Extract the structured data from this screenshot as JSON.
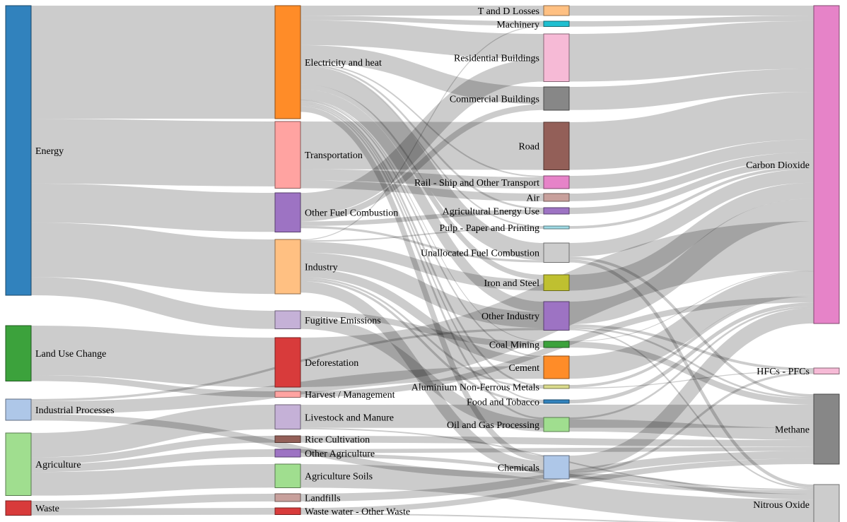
{
  "chart_data": {
    "type": "sankey",
    "title": "",
    "nodes": [
      {
        "name": "Energy",
        "column": 0,
        "color": "#3182bd"
      },
      {
        "name": "Land Use Change",
        "column": 0,
        "color": "#3ca23c"
      },
      {
        "name": "Industrial Processes",
        "column": 0,
        "color": "#aec7e8"
      },
      {
        "name": "Agriculture",
        "column": 0,
        "color": "#a0de8f"
      },
      {
        "name": "Waste",
        "column": 0,
        "color": "#d83b3b"
      },
      {
        "name": "Electricity and heat",
        "column": 1,
        "color": "#ff8c28"
      },
      {
        "name": "Transportation",
        "column": 1,
        "color": "#ffa3a1"
      },
      {
        "name": "Other Fuel Combustion",
        "column": 1,
        "color": "#9d73c3"
      },
      {
        "name": "Industry",
        "column": 1,
        "color": "#ffc082"
      },
      {
        "name": "Fugitive Emissions",
        "column": 1,
        "color": "#c5b1d7"
      },
      {
        "name": "Deforestation",
        "column": 1,
        "color": "#d83b3b"
      },
      {
        "name": "Harvest / Management",
        "column": 1,
        "color": "#ffa3a1"
      },
      {
        "name": "Livestock and Manure",
        "column": 1,
        "color": "#c5b1d7"
      },
      {
        "name": "Rice Cultivation",
        "column": 1,
        "color": "#935f58"
      },
      {
        "name": "Other Agriculture",
        "column": 1,
        "color": "#9d73c3"
      },
      {
        "name": "Agriculture Soils",
        "column": 1,
        "color": "#a0de8f"
      },
      {
        "name": "Landfills",
        "column": 1,
        "color": "#c8a09c"
      },
      {
        "name": "Waste water - Other Waste",
        "column": 1,
        "color": "#d83b3b"
      },
      {
        "name": "T and D Losses",
        "column": 2,
        "color": "#ffc082"
      },
      {
        "name": "Machinery",
        "column": 2,
        "color": "#1fbfd0"
      },
      {
        "name": "Residential Buildings",
        "column": 2,
        "color": "#f6bad6"
      },
      {
        "name": "Commercial Buildings",
        "column": 2,
        "color": "#878787"
      },
      {
        "name": "Road",
        "column": 2,
        "color": "#935f58"
      },
      {
        "name": "Rail - Ship and Other Transport",
        "column": 2,
        "color": "#e683c8"
      },
      {
        "name": "Air",
        "column": 2,
        "color": "#c8a09c"
      },
      {
        "name": "Agricultural Energy Use",
        "column": 2,
        "color": "#9d73c3"
      },
      {
        "name": "Pulp - Paper and Printing",
        "column": 2,
        "color": "#9edae5"
      },
      {
        "name": "Unallocated Fuel Combustion",
        "column": 2,
        "color": "#cccccc"
      },
      {
        "name": "Iron and Steel",
        "column": 2,
        "color": "#bfc030"
      },
      {
        "name": "Other Industry",
        "column": 2,
        "color": "#9d73c3"
      },
      {
        "name": "Coal Mining",
        "column": 2,
        "color": "#3ca23c"
      },
      {
        "name": "Cement",
        "column": 2,
        "color": "#ff8c28"
      },
      {
        "name": "Aluminium Non-Ferrous Metals",
        "column": 2,
        "color": "#dbdc8d"
      },
      {
        "name": "Food and Tobacco",
        "column": 2,
        "color": "#3182bd"
      },
      {
        "name": "Oil and Gas Processing",
        "column": 2,
        "color": "#a0de8f"
      },
      {
        "name": "Chemicals",
        "column": 2,
        "color": "#aec7e8"
      },
      {
        "name": "Carbon Dioxide",
        "column": 3,
        "color": "#e683c8"
      },
      {
        "name": "HFCs - PFCs",
        "column": 3,
        "color": "#f6bad6"
      },
      {
        "name": "Methane",
        "column": 3,
        "color": "#878787"
      },
      {
        "name": "Nitrous Oxide",
        "column": 3,
        "color": "#cccccc"
      }
    ],
    "links": [
      {
        "source": "Agriculture",
        "target": "Agriculture Soils",
        "value": 5.2
      },
      {
        "source": "Agriculture",
        "target": "Livestock and Manure",
        "value": 5.4
      },
      {
        "source": "Agriculture",
        "target": "Other Agriculture",
        "value": 1.7
      },
      {
        "source": "Agriculture",
        "target": "Rice Cultivation",
        "value": 1.5
      },
      {
        "source": "Energy",
        "target": "Fugitive Emissions",
        "value": 4.0
      },
      {
        "source": "Energy",
        "target": "Industry",
        "value": 12.0
      },
      {
        "source": "Energy",
        "target": "Electricity and heat",
        "value": 24.9
      },
      {
        "source": "Energy",
        "target": "Transportation",
        "value": 14.3
      },
      {
        "source": "Energy",
        "target": "Other Fuel Combustion",
        "value": 8.6
      },
      {
        "source": "Industrial Processes",
        "target": "Cement",
        "value": 2.8
      },
      {
        "source": "Industrial Processes",
        "target": "Chemicals",
        "value": 1.4
      },
      {
        "source": "Industrial Processes",
        "target": "Other Industry",
        "value": 0.5
      },
      {
        "source": "Land Use Change",
        "target": "Deforestation",
        "value": 10.9
      },
      {
        "source": "Land Use Change",
        "target": "Harvest / Management",
        "value": 1.3
      },
      {
        "source": "Waste",
        "target": "Landfills",
        "value": 1.7
      },
      {
        "source": "Waste",
        "target": "Waste water - Other Waste",
        "value": 1.5
      },
      {
        "source": "Electricity and heat",
        "target": "Residential Buildings",
        "value": 5.5
      },
      {
        "source": "Electricity and heat",
        "target": "Commercial Buildings",
        "value": 3.8
      },
      {
        "source": "Electricity and heat",
        "target": "Iron and Steel",
        "value": 1.1
      },
      {
        "source": "Electricity and heat",
        "target": "Other Industry",
        "value": 2.3
      },
      {
        "source": "Electricity and heat",
        "target": "Aluminium Non-Ferrous Metals",
        "value": 0.4
      },
      {
        "source": "Electricity and heat",
        "target": "Food and Tobacco",
        "value": 0.3
      },
      {
        "source": "Electricity and heat",
        "target": "Chemicals",
        "value": 1.2
      },
      {
        "source": "Electricity and heat",
        "target": "Pulp - Paper and Printing",
        "value": 0.3
      },
      {
        "source": "Electricity and heat",
        "target": "Machinery",
        "value": 1.0
      },
      {
        "source": "Electricity and heat",
        "target": "Agricultural Energy Use",
        "value": 0.4
      },
      {
        "source": "Electricity and heat",
        "target": "T and D Losses",
        "value": 2.2
      },
      {
        "source": "Electricity and heat",
        "target": "Unallocated Fuel Combustion",
        "value": 3.8
      },
      {
        "source": "Electricity and heat",
        "target": "Coal Mining",
        "value": 0.1
      },
      {
        "source": "Electricity and heat",
        "target": "Oil and Gas Processing",
        "value": 0.4
      },
      {
        "source": "Electricity and heat",
        "target": "Cement",
        "value": 0.3
      },
      {
        "source": "Electricity and heat",
        "target": "Rail - Ship and Other Transport",
        "value": 0.3
      },
      {
        "source": "Transportation",
        "target": "Road",
        "value": 10.5
      },
      {
        "source": "Transportation",
        "target": "Air",
        "value": 1.7
      },
      {
        "source": "Transportation",
        "target": "Rail - Ship and Other Transport",
        "value": 2.5
      },
      {
        "source": "Other Fuel Combustion",
        "target": "Residential Buildings",
        "value": 5.0
      },
      {
        "source": "Other Fuel Combustion",
        "target": "Commercial Buildings",
        "value": 1.3
      },
      {
        "source": "Other Fuel Combustion",
        "target": "Unallocated Fuel Combustion",
        "value": 0.5
      },
      {
        "source": "Other Fuel Combustion",
        "target": "Agricultural Energy Use",
        "value": 1.0
      },
      {
        "source": "Industry",
        "target": "Iron and Steel",
        "value": 2.4
      },
      {
        "source": "Industry",
        "target": "Aluminium Non-Ferrous Metals",
        "value": 0.4
      },
      {
        "source": "Industry",
        "target": "Machinery",
        "value": 0.2
      },
      {
        "source": "Industry",
        "target": "Food and Tobacco",
        "value": 0.5
      },
      {
        "source": "Industry",
        "target": "Chemicals",
        "value": 2.5
      },
      {
        "source": "Industry",
        "target": "Cement",
        "value": 1.9
      },
      {
        "source": "Industry",
        "target": "Pulp - Paper and Printing",
        "value": 0.3
      },
      {
        "source": "Industry",
        "target": "Other Industry",
        "value": 3.5
      },
      {
        "source": "Fugitive Emissions",
        "target": "Coal Mining",
        "value": 1.3
      },
      {
        "source": "Fugitive Emissions",
        "target": "Oil and Gas Processing",
        "value": 2.7
      },
      {
        "source": "Deforestation",
        "target": "Carbon Dioxide",
        "value": 10.9
      },
      {
        "source": "Harvest / Management",
        "target": "Carbon Dioxide",
        "value": 1.3
      },
      {
        "source": "Livestock and Manure",
        "target": "Methane",
        "value": 5.1
      },
      {
        "source": "Livestock and Manure",
        "target": "Nitrous Oxide",
        "value": 0.3
      },
      {
        "source": "Rice Cultivation",
        "target": "Methane",
        "value": 1.5
      },
      {
        "source": "Other Agriculture",
        "target": "Methane",
        "value": 0.9
      },
      {
        "source": "Other Agriculture",
        "target": "Nitrous Oxide",
        "value": 0.8
      },
      {
        "source": "Agriculture Soils",
        "target": "Nitrous Oxide",
        "value": 5.2
      },
      {
        "source": "Landfills",
        "target": "Methane",
        "value": 1.7
      },
      {
        "source": "Waste water - Other Waste",
        "target": "Methane",
        "value": 1.2
      },
      {
        "source": "Waste water - Other Waste",
        "target": "Nitrous Oxide",
        "value": 0.3
      },
      {
        "source": "T and D Losses",
        "target": "Carbon Dioxide",
        "value": 2.2
      },
      {
        "source": "Machinery",
        "target": "Carbon Dioxide",
        "value": 1.2
      },
      {
        "source": "Residential Buildings",
        "target": "Carbon Dioxide",
        "value": 10.5
      },
      {
        "source": "Commercial Buildings",
        "target": "Carbon Dioxide",
        "value": 5.1
      },
      {
        "source": "Road",
        "target": "Carbon Dioxide",
        "value": 10.5
      },
      {
        "source": "Rail - Ship and Other Transport",
        "target": "Carbon Dioxide",
        "value": 2.8
      },
      {
        "source": "Air",
        "target": "Carbon Dioxide",
        "value": 1.7
      },
      {
        "source": "Agricultural Energy Use",
        "target": "Carbon Dioxide",
        "value": 1.4
      },
      {
        "source": "Pulp - Paper and Printing",
        "target": "Carbon Dioxide",
        "value": 0.6
      },
      {
        "source": "Unallocated Fuel Combustion",
        "target": "Carbon Dioxide",
        "value": 3.0
      },
      {
        "source": "Unallocated Fuel Combustion",
        "target": "Methane",
        "value": 0.6
      },
      {
        "source": "Unallocated Fuel Combustion",
        "target": "Nitrous Oxide",
        "value": 0.7
      },
      {
        "source": "Iron and Steel",
        "target": "Carbon Dioxide",
        "value": 3.5
      },
      {
        "source": "Other Industry",
        "target": "Carbon Dioxide",
        "value": 5.0
      },
      {
        "source": "Other Industry",
        "target": "HFCs - PFCs",
        "value": 0.6
      },
      {
        "source": "Other Industry",
        "target": "Methane",
        "value": 0.4
      },
      {
        "source": "Other Industry",
        "target": "Nitrous Oxide",
        "value": 0.3
      },
      {
        "source": "Coal Mining",
        "target": "Carbon Dioxide",
        "value": 0.1
      },
      {
        "source": "Coal Mining",
        "target": "Methane",
        "value": 1.3
      },
      {
        "source": "Cement",
        "target": "Carbon Dioxide",
        "value": 5.0
      },
      {
        "source": "Aluminium Non-Ferrous Metals",
        "target": "Carbon Dioxide",
        "value": 0.6
      },
      {
        "source": "Aluminium Non-Ferrous Metals",
        "target": "HFCs - PFCs",
        "value": 0.2
      },
      {
        "source": "Food and Tobacco",
        "target": "Carbon Dioxide",
        "value": 0.8
      },
      {
        "source": "Oil and Gas Processing",
        "target": "Carbon Dioxide",
        "value": 0.4
      },
      {
        "source": "Oil and Gas Processing",
        "target": "Methane",
        "value": 2.7
      },
      {
        "source": "Chemicals",
        "target": "Carbon Dioxide",
        "value": 3.4
      },
      {
        "source": "Chemicals",
        "target": "HFCs - PFCs",
        "value": 0.5
      },
      {
        "source": "Chemicals",
        "target": "Nitrous Oxide",
        "value": 1.2
      }
    ]
  }
}
